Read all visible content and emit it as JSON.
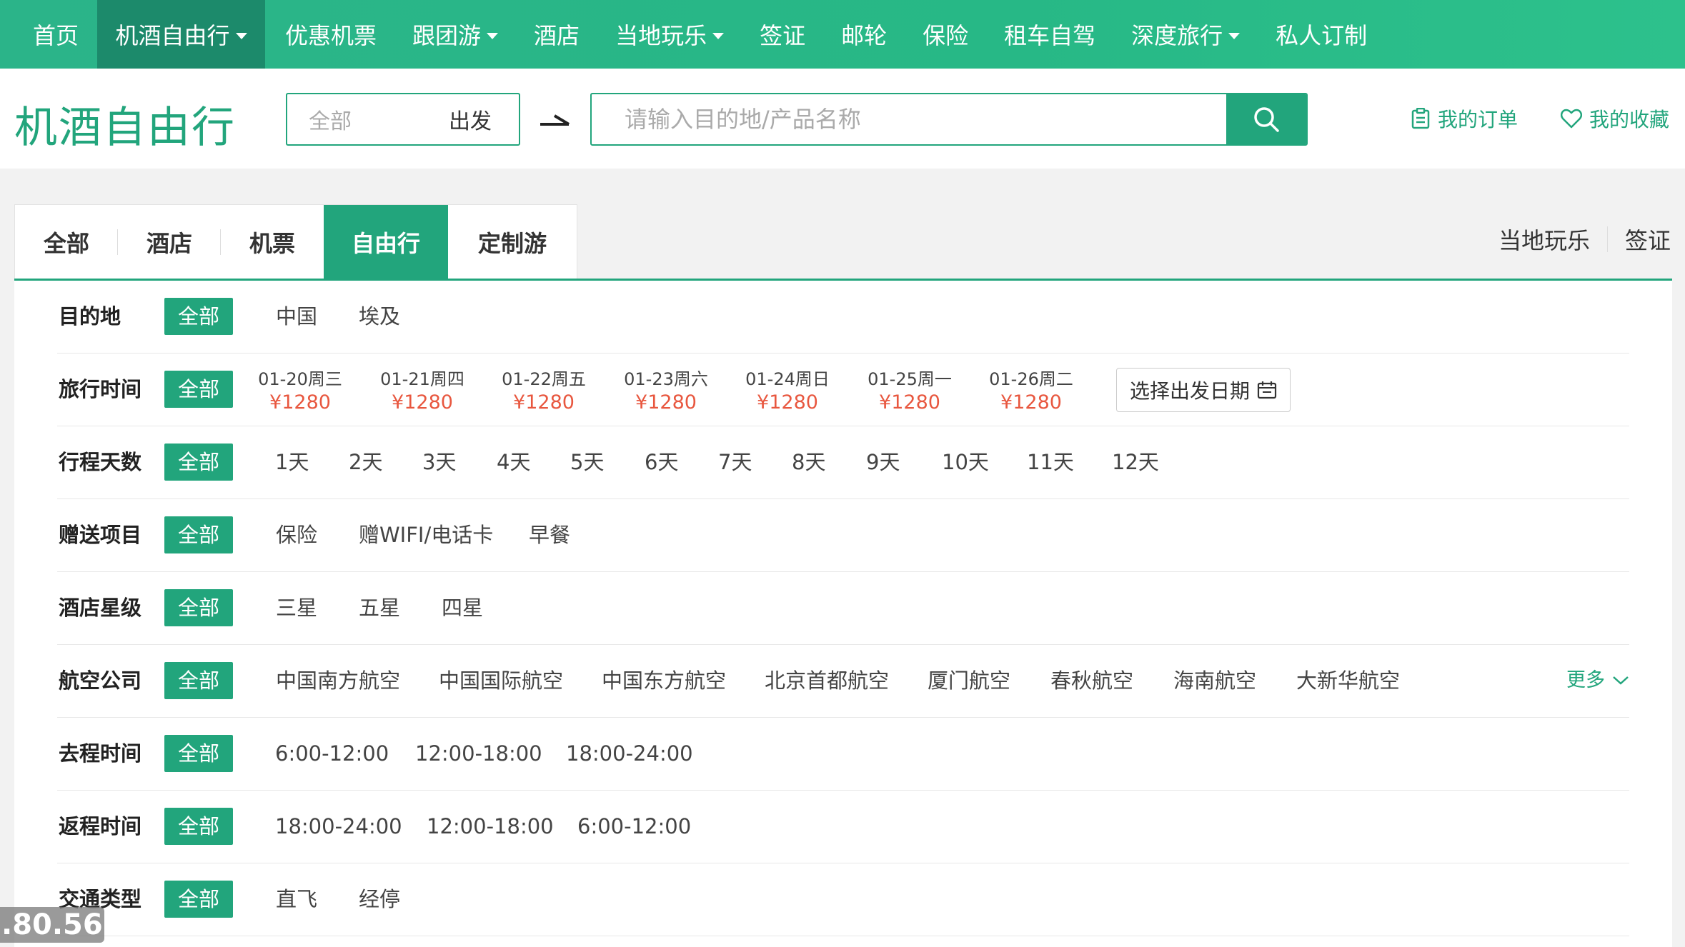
{
  "topnav": {
    "items": [
      {
        "label": "首页"
      },
      {
        "label": "机酒自由行"
      },
      {
        "label": "优惠机票"
      },
      {
        "label": "跟团游"
      },
      {
        "label": "酒店"
      },
      {
        "label": "当地玩乐"
      },
      {
        "label": "签证"
      },
      {
        "label": "邮轮"
      },
      {
        "label": "保险"
      },
      {
        "label": "租车自驾"
      },
      {
        "label": "深度旅行"
      },
      {
        "label": "私人订制"
      }
    ]
  },
  "header": {
    "title": "机酒自由行",
    "origin_value": "全部",
    "origin_suffix": "出发",
    "search_placeholder": "请输入目的地/产品名称",
    "my_orders": "我的订单",
    "my_favorites": "我的收藏",
    "search_icon": "search-icon",
    "orders_icon": "clipboard-icon",
    "favorites_icon": "heart-icon"
  },
  "tabs": {
    "items": [
      {
        "label": "全部"
      },
      {
        "label": "酒店"
      },
      {
        "label": "机票"
      },
      {
        "label": "自由行"
      },
      {
        "label": "定制游"
      }
    ],
    "right_links": [
      {
        "label": "当地玩乐"
      },
      {
        "label": "签证"
      }
    ]
  },
  "filters": {
    "all_label": "全部",
    "destination": {
      "label": "目的地",
      "options": [
        "中国",
        "埃及"
      ]
    },
    "travel_time": {
      "label": "旅行时间",
      "dates": [
        {
          "date": "01-20周三",
          "price": "¥1280"
        },
        {
          "date": "01-21周四",
          "price": "¥1280"
        },
        {
          "date": "01-22周五",
          "price": "¥1280"
        },
        {
          "date": "01-23周六",
          "price": "¥1280"
        },
        {
          "date": "01-24周日",
          "price": "¥1280"
        },
        {
          "date": "01-25周一",
          "price": "¥1280"
        },
        {
          "date": "01-26周二",
          "price": "¥1280"
        }
      ],
      "picker_label": "选择出发日期"
    },
    "days": {
      "label": "行程天数",
      "options": [
        "1天",
        "2天",
        "3天",
        "4天",
        "5天",
        "6天",
        "7天",
        "8天",
        "9天",
        "10天",
        "11天",
        "12天"
      ]
    },
    "gifts": {
      "label": "赠送项目",
      "options": [
        "保险",
        "赠WIFI/电话卡",
        "早餐"
      ]
    },
    "hotel_star": {
      "label": "酒店星级",
      "options": [
        "三星",
        "五星",
        "四星"
      ]
    },
    "airline": {
      "label": "航空公司",
      "options": [
        "中国南方航空",
        "中国国际航空",
        "中国东方航空",
        "北京首都航空",
        "厦门航空",
        "春秋航空",
        "海南航空",
        "大新华航空"
      ],
      "more_label": "更多"
    },
    "outbound_time": {
      "label": "去程时间",
      "options": [
        "6:00-12:00",
        "12:00-18:00",
        "18:00-24:00"
      ]
    },
    "return_time": {
      "label": "返程时间",
      "options": [
        "18:00-24:00",
        "12:00-18:00",
        "6:00-12:00"
      ]
    },
    "transport": {
      "label": "交通类型",
      "options": [
        "直飞",
        "经停"
      ]
    }
  },
  "overlay": {
    "text": ".80.56"
  },
  "colors": {
    "brand_green": "#22a57c",
    "price_red": "#e8573f",
    "active_nav": "#1c8a6b"
  }
}
